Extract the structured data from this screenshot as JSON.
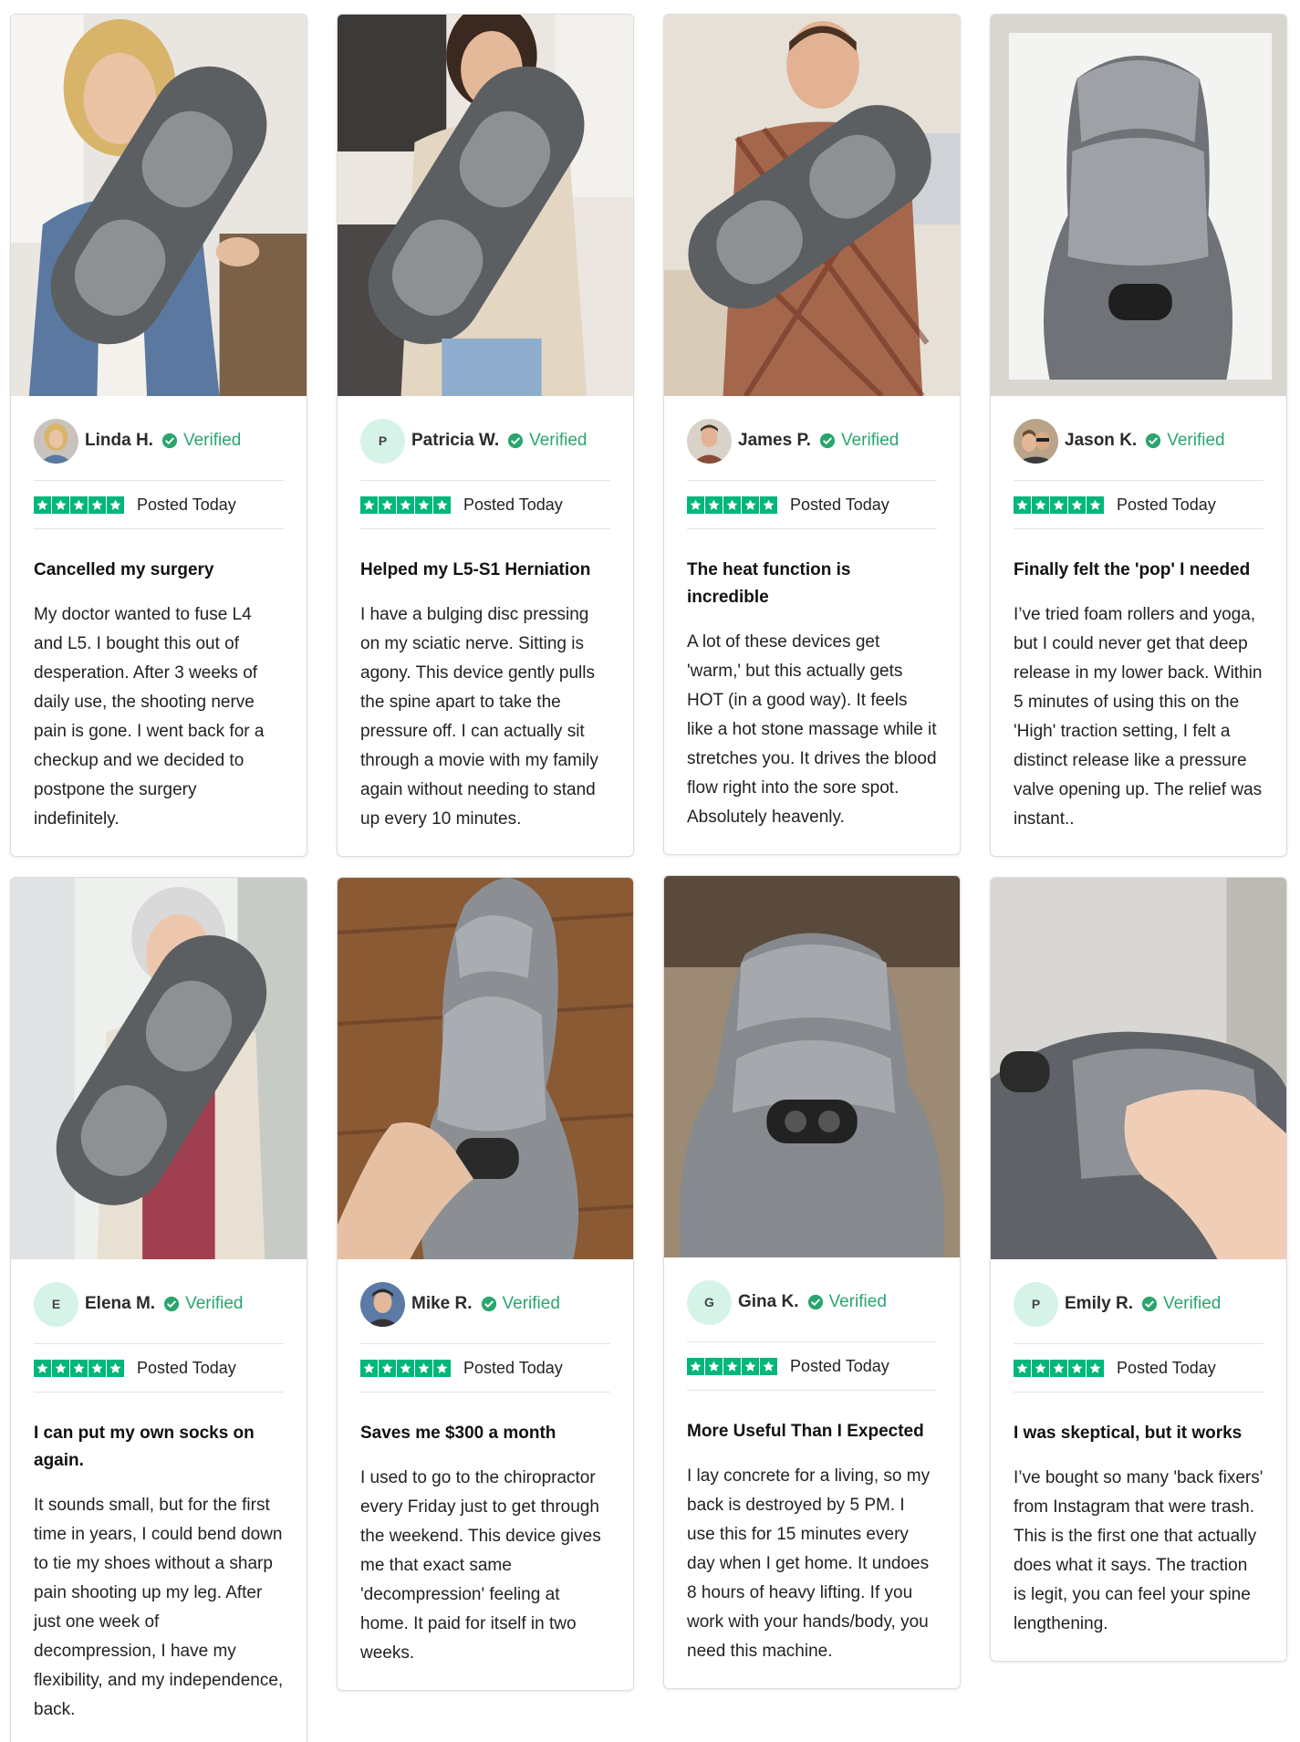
{
  "colors": {
    "accent_green": "#00b67a",
    "verified_green": "#2aa56e",
    "avatar_bg": "#d6f3e8"
  },
  "reviews": [
    {
      "name": "Linda H.",
      "verified": "Verified",
      "posted": "Posted Today",
      "rating": 5,
      "avatar": "photo",
      "title": "Cancelled my surgery",
      "text": "My doctor wanted to fuse L4 and L5. I bought this out of desperation. After 3 weeks of daily use, the shooting nerve pain is gone. I went back for a checkup and we decided to postpone the surgery indefinitely."
    },
    {
      "name": "Patricia W.",
      "verified": "Verified",
      "posted": "Posted Today",
      "rating": 5,
      "avatar": "P",
      "title": "Helped my L5-S1 Herniation",
      "text": "I have a bulging disc pressing on my sciatic nerve. Sitting is agony. This device gently pulls the spine apart to take the pressure off. I can actually sit through a movie with my family again without needing to stand up every 10 minutes."
    },
    {
      "name": "James P.",
      "verified": "Verified",
      "posted": "Posted Today",
      "rating": 5,
      "avatar": "photo",
      "title": "The heat function is incredible",
      "text": "A lot of these devices get 'warm,' but this actually gets HOT (in a good way). It feels like a hot stone massage while it stretches you. It drives the blood flow right into the sore spot. Absolutely heavenly."
    },
    {
      "name": "Jason K.",
      "verified": "Verified",
      "posted": "Posted Today",
      "rating": 5,
      "avatar": "photo",
      "title": "Finally felt the 'pop' I needed",
      "text": "I’ve tried foam rollers and yoga, but I could never get that deep release in my lower back. Within 5 minutes of using this on the 'High' traction setting, I felt a distinct release like a pressure valve opening up. The relief was instant.."
    },
    {
      "name": "Elena M.",
      "verified": "Verified",
      "posted": "Posted Today",
      "rating": 5,
      "avatar": "E",
      "title": "I can put my own socks on again.",
      "text": "It sounds small, but for the first time in years, I could bend down to tie my shoes without a sharp pain shooting up my leg. After just one week of decompression, I have my flexibility, and my independence, back."
    },
    {
      "name": "Mike R.",
      "verified": "Verified",
      "posted": "Posted Today",
      "rating": 5,
      "avatar": "photo",
      "title": "Saves me $300 a month",
      "text": "I used to go to the chiropractor every Friday just to get through the weekend. This device gives me that exact same 'decompression' feeling at home. It paid for itself in two weeks."
    },
    {
      "name": "Gina K.",
      "verified": "Verified",
      "posted": "Posted Today",
      "rating": 5,
      "avatar": "G",
      "title": "More Useful Than I Expected",
      "text": "I lay concrete for a living, so my back is destroyed by 5 PM. I use this for 15 minutes every day when I get home. It undoes 8 hours of heavy lifting. If you work with your hands/body, you need this machine."
    },
    {
      "name": "Emily R.",
      "verified": "Verified",
      "posted": "Posted Today",
      "rating": 5,
      "avatar": "P",
      "title": "I was skeptical, but it works",
      "text": "I’ve bought so many 'back fixers' from Instagram that were trash. This is the first one that actually does what it says. The traction is legit, you can feel your spine lengthening."
    }
  ]
}
